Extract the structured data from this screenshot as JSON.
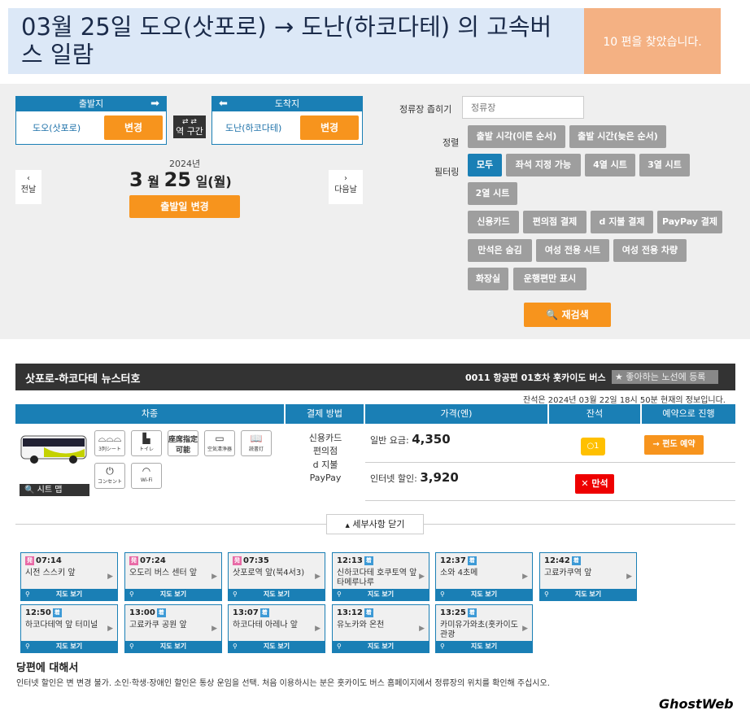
{
  "header": {
    "title": "03월 25일 도오(삿포로) → 도난(하코다테) 의 고속버스 일람",
    "result_count": "10 편을 찾았습니다."
  },
  "search": {
    "departure_label": "출발지",
    "departure_station": "도오(삿포로)",
    "arrival_label": "도착지",
    "arrival_station": "도난(하코다테)",
    "change_label": "변경",
    "swap_label_1": "역",
    "swap_label_2": "구간",
    "prev_day": "전날",
    "next_day": "다음날",
    "year": "2024년",
    "month": "3",
    "month_suffix": "월",
    "day": "25",
    "day_suffix": "일(월)",
    "change_date": "출발일 변경",
    "stop_filter_label": "정류장 좁히기",
    "stop_placeholder": "정류장",
    "sort_label": "정렬",
    "sort_options": [
      "출발 시각(이른 순서)",
      "출발 시간(늦은 순서)"
    ],
    "filter_label": "필터링",
    "filters": [
      "모두",
      "좌석 지정 가능",
      "4열 시트",
      "3열 시트",
      "2열 시트",
      "신용카드",
      "편의점 결제",
      "d 지불 결제",
      "PayPay 결제",
      "만석은 숨김",
      "여성 전용 시트",
      "여성 전용 차량",
      "화장실",
      "운행편만 표시"
    ],
    "research_label": "재검색"
  },
  "result": {
    "route_name": "삿포로-하코다테 뉴스터호",
    "company": "0011 항공편 01호차  홋카이도 버스",
    "fav_label": "★ 좋아하는 노선에 등록",
    "info_time": "잔석은 2024년 03월 22일 18시 50분 현재의 정보입니다.",
    "columns": [
      "차종",
      "결제 방법",
      "가격(엔)",
      "잔석",
      "예약으로 진행"
    ],
    "facilities": [
      "3列シート",
      "トイレ",
      "座席指定 可能",
      "空気清浄器",
      "読書灯",
      "コンセント",
      "Wi-Fi"
    ],
    "seat_map": "시트 맵",
    "payments": [
      "신용카드",
      "편의점",
      "d 지불",
      "PayPay"
    ],
    "fare_regular_label": "일반 요금:",
    "fare_regular": "4,350",
    "fare_internet_label": "인터넷 할인:",
    "fare_internet": "3,920",
    "seat_few": "1",
    "seat_full": "만석",
    "reserve_label": "→ 편도 예약",
    "toggle_details": "세부사항 닫기"
  },
  "stops": [
    {
      "time": "07:14",
      "type": "dep",
      "name": "시전 스스키 앞"
    },
    {
      "time": "07:24",
      "type": "dep",
      "name": "오도리 버스 센터 앞"
    },
    {
      "time": "07:35",
      "type": "dep",
      "name": "삿포로역 앞(북4서3)"
    },
    {
      "time": "12:13",
      "type": "arr",
      "name": "신하코다테 호쿠토역 앞 타메루나루"
    },
    {
      "time": "12:37",
      "type": "arr",
      "name": "소와 4초메"
    },
    {
      "time": "12:42",
      "type": "arr",
      "name": "고료카쿠역 앞"
    },
    {
      "time": "12:50",
      "type": "arr",
      "name": "하코다테역 앞 터미널"
    },
    {
      "time": "13:00",
      "type": "arr",
      "name": "고료카쿠 공원 앞"
    },
    {
      "time": "13:07",
      "type": "arr",
      "name": "하코다테 아레나 앞"
    },
    {
      "time": "13:12",
      "type": "arr",
      "name": "유노카와 온천"
    },
    {
      "time": "13:25",
      "type": "arr",
      "name": "카미유가와초(홋카이도 관광"
    }
  ],
  "stop_badges": {
    "dep": "発",
    "arr": "着"
  },
  "stop_map_label": "지도 보기",
  "about": {
    "title": "당편에 대해서",
    "text": "인터넷 할인은 변 변경 불가. 소인·학생·장애인 할인은 통상 운임을 선택. 처음 이용하시는 분은 홋카이도 버스 홈페이지에서 정류장의 위치를 확인해 주십시오."
  },
  "watermark": "GhostWeb"
}
